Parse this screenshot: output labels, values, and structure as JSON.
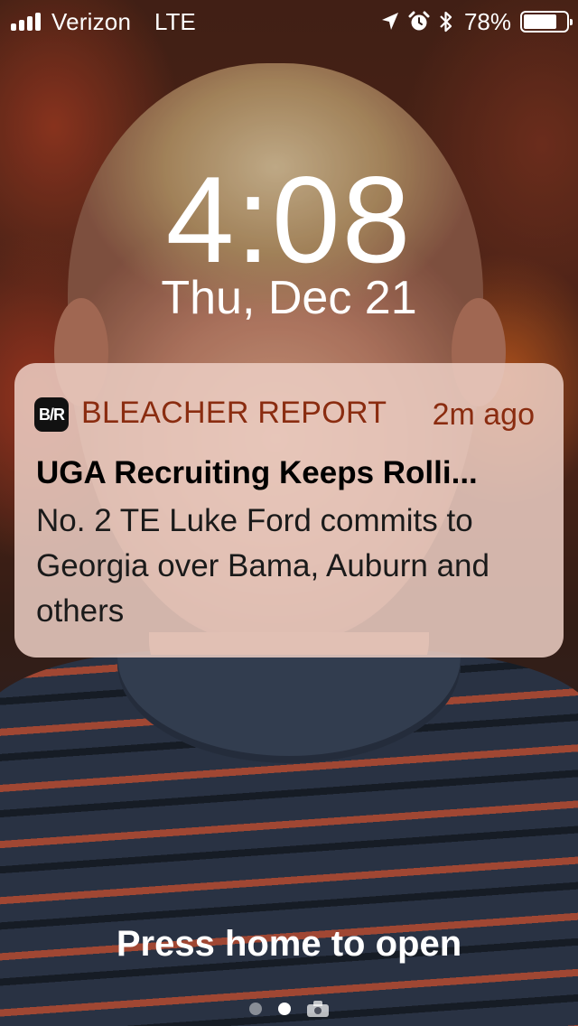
{
  "status_bar": {
    "carrier": "Verizon",
    "network": "LTE",
    "signal_bars": 4,
    "icons": [
      "location-arrow-icon",
      "alarm-clock-icon",
      "bluetooth-icon"
    ],
    "battery_percent": "78%",
    "battery_level": 0.78
  },
  "lock_screen": {
    "time": "4:08",
    "date": "Thu, Dec 21"
  },
  "notification": {
    "app_icon_text": "B/R",
    "app_name": "BLEACHER REPORT",
    "time_ago": "2m ago",
    "title": "UGA Recruiting Keeps Rolli...",
    "body": "No. 2 TE Luke Ford commits to Georgia over Bama, Auburn and others",
    "accent_color": "#8a2c10"
  },
  "footer": {
    "unlock_hint": "Press home to open",
    "pages": [
      "widgets-page",
      "lock-page",
      "camera-page"
    ],
    "active_page": 1
  }
}
